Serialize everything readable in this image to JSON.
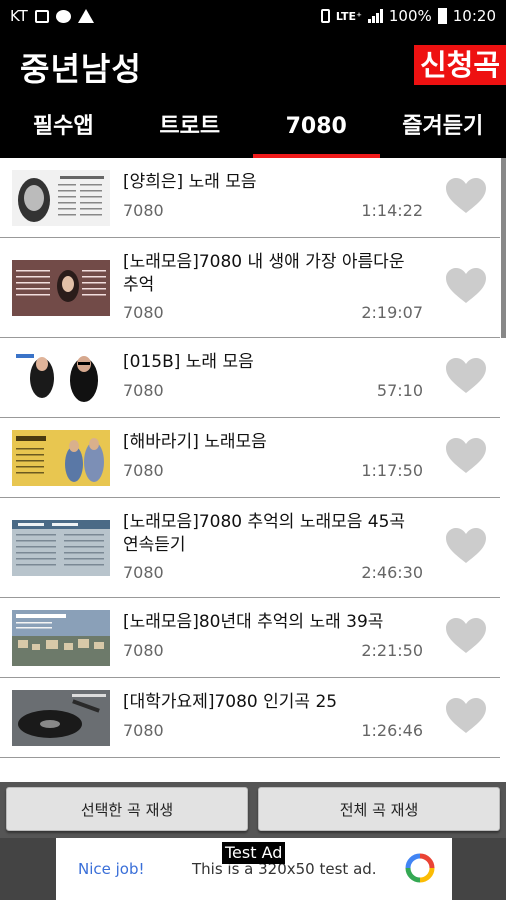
{
  "status_bar": {
    "carrier": "KT",
    "network": "LTE⁺",
    "battery": "100%",
    "time": "10:20"
  },
  "header": {
    "title": "중년남성",
    "request_button": "신청곡"
  },
  "tabs": [
    {
      "label": "필수앱",
      "active": false
    },
    {
      "label": "트로트",
      "active": false
    },
    {
      "label": "7080",
      "active": true
    },
    {
      "label": "즐겨듣기",
      "active": false
    }
  ],
  "songs": [
    {
      "title": "[양희은] 노래 모음",
      "category": "7080",
      "duration": "1:14:22"
    },
    {
      "title": "[노래모음]7080 내 생애 가장 아름다운 추억",
      "category": "7080",
      "duration": "2:19:07"
    },
    {
      "title": "[015B] 노래 모음",
      "category": "7080",
      "duration": "57:10"
    },
    {
      "title": "[해바라기] 노래모음",
      "category": "7080",
      "duration": "1:17:50"
    },
    {
      "title": "[노래모음]7080 추억의 노래모음 45곡 연속듣기",
      "category": "7080",
      "duration": "2:46:30"
    },
    {
      "title": "[노래모음]80년대 추억의 노래 39곡",
      "category": "7080",
      "duration": "2:21:50"
    },
    {
      "title": "[대학가요제]7080 인기곡 25",
      "category": "7080",
      "duration": "1:26:46"
    }
  ],
  "buttons": {
    "play_selected": "선택한 곡 재생",
    "play_all": "전체 곡 재생"
  },
  "ad": {
    "badge": "Test Ad",
    "nice": "Nice job!",
    "text": "This is a 320x50 test ad."
  },
  "colors": {
    "accent_red": "#ee1111",
    "background": "#000000",
    "heart": "#cccccc"
  }
}
